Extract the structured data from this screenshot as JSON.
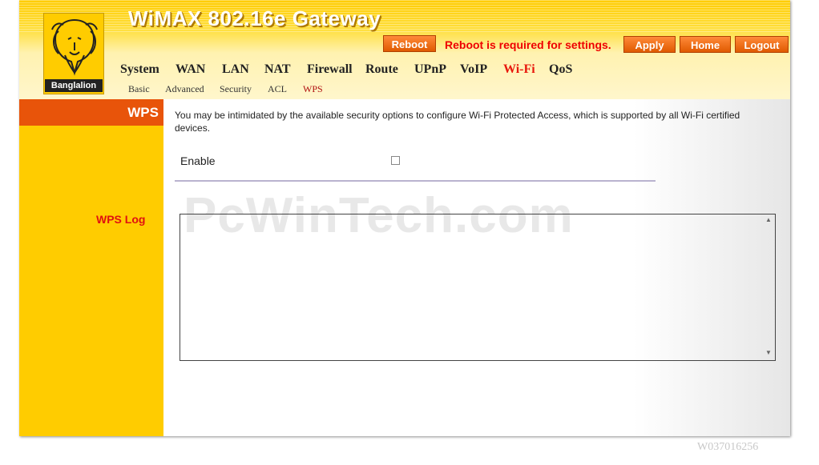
{
  "header": {
    "title": "WiMAX 802.16e Gateway",
    "logo_text": "Banglalion",
    "reboot_button": "Reboot",
    "reboot_message": "Reboot is required for settings.",
    "apply_button": "Apply",
    "home_button": "Home",
    "logout_button": "Logout"
  },
  "nav": {
    "items": [
      "System",
      "WAN",
      "LAN",
      "NAT",
      "Firewall",
      "Route",
      "UPnP",
      "VoIP",
      "Wi-Fi",
      "QoS"
    ],
    "active": "Wi-Fi"
  },
  "subnav": {
    "items": [
      "Basic",
      "Advanced",
      "Security",
      "ACL",
      "WPS"
    ],
    "active": "WPS"
  },
  "sidebar": {
    "heading": "WPS",
    "link": "WPS Log"
  },
  "main": {
    "description": "You may be intimidated by the available security options to configure Wi-Fi Protected Access, which is supported by all Wi-Fi certified devices.",
    "enable_label": "Enable",
    "enable_checked": false,
    "log_value": ""
  },
  "watermark": "PcWinTech.com",
  "footer_code": "W037016256",
  "colors": {
    "accent_orange": "#e8540a",
    "brand_yellow": "#ffcc00",
    "alert_red": "#ee0000"
  }
}
